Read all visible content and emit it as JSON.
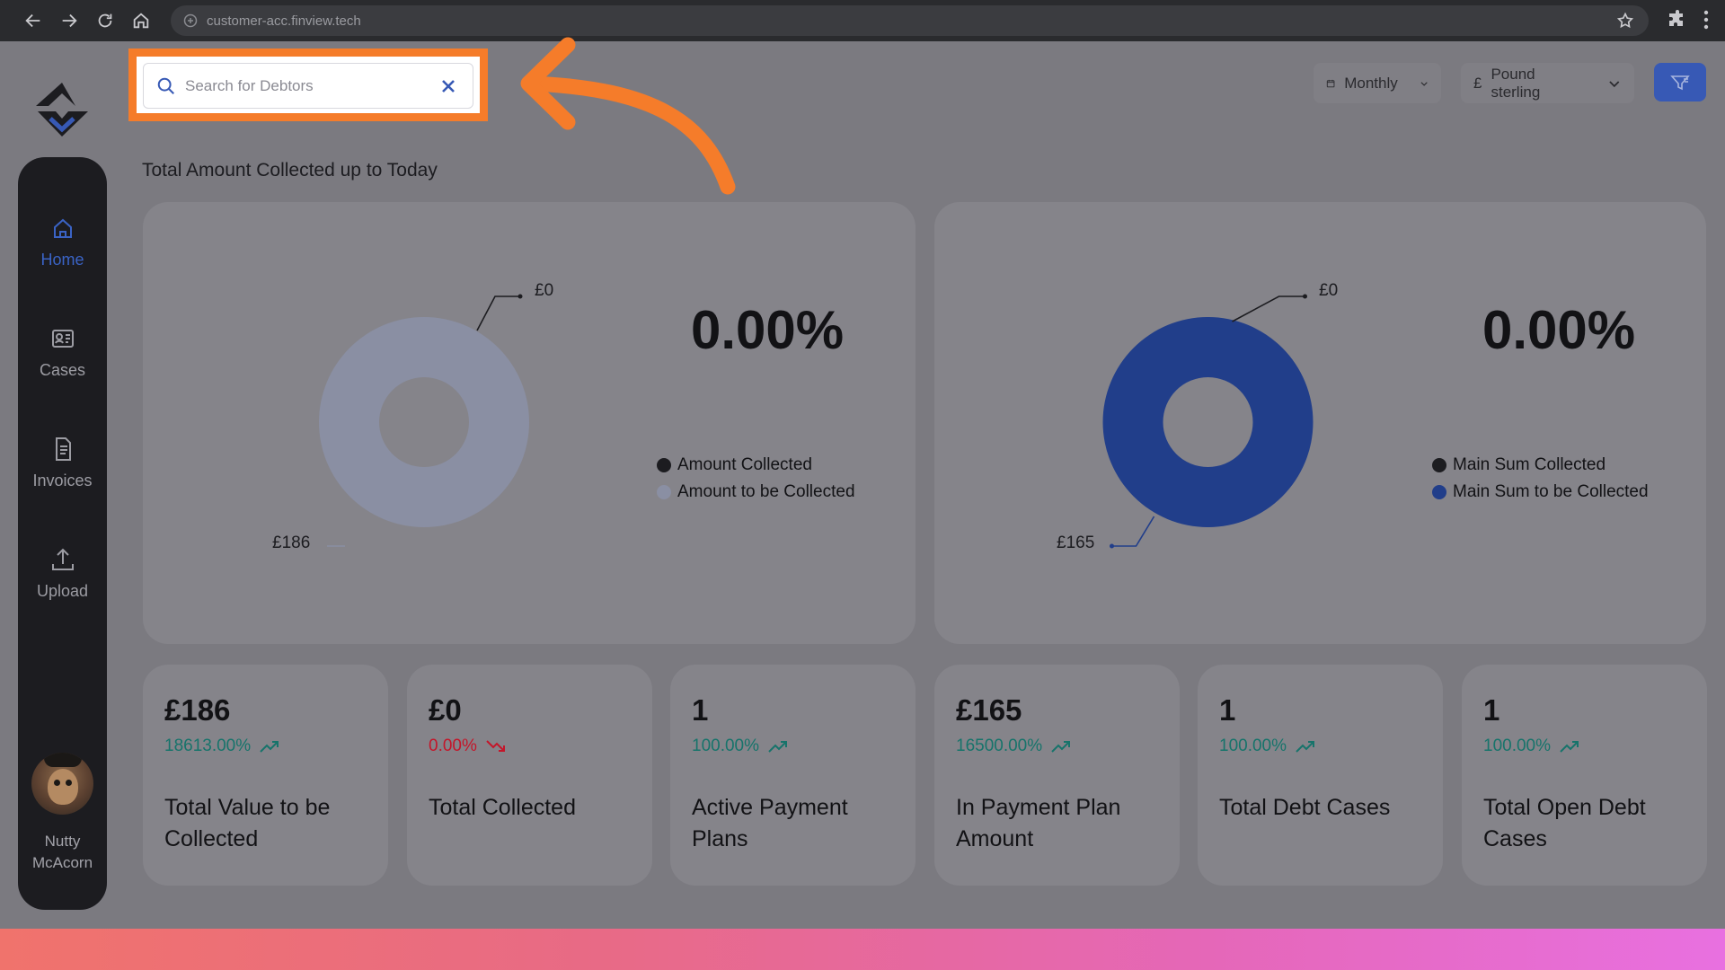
{
  "browser": {
    "url": "customer-acc.finview.tech"
  },
  "search": {
    "placeholder": "Search for Debtors"
  },
  "controls": {
    "period": "Monthly",
    "currency_symbol": "£",
    "currency": "Pound sterling"
  },
  "sidebar": {
    "items": [
      {
        "label": "Home",
        "icon": "home-icon",
        "active": true
      },
      {
        "label": "Cases",
        "icon": "id-card-icon"
      },
      {
        "label": "Invoices",
        "icon": "document-icon"
      },
      {
        "label": "Upload",
        "icon": "upload-icon"
      }
    ],
    "user_first": "Nutty",
    "user_last": "McAcorn"
  },
  "section_title": "Total Amount Collected up to Today",
  "charts": {
    "left": {
      "percent": "0.00%",
      "label_collected": "£0",
      "label_remaining": "£186",
      "legend": [
        "Amount Collected",
        "Amount to be Collected"
      ]
    },
    "right": {
      "percent": "0.00%",
      "label_collected": "£0",
      "label_remaining": "£165",
      "legend": [
        "Main Sum Collected",
        "Main Sum to be Collected"
      ]
    }
  },
  "chart_data": [
    {
      "type": "pie",
      "categories": [
        "Amount Collected",
        "Amount to be Collected"
      ],
      "values": [
        0,
        186
      ],
      "data_labels": [
        "£0",
        "£186"
      ],
      "colors": [
        "#1c1c20",
        "#8a8fa3"
      ]
    },
    {
      "type": "pie",
      "categories": [
        "Main Sum Collected",
        "Main Sum to be Collected"
      ],
      "values": [
        0,
        165
      ],
      "data_labels": [
        "£0",
        "£165"
      ],
      "colors": [
        "#1c1c20",
        "#213e8a"
      ]
    }
  ],
  "stats": [
    {
      "value": "£186",
      "change": "18613.00%",
      "trend": "up",
      "label": "Total Value to be Collected"
    },
    {
      "value": "£0",
      "change": "0.00%",
      "trend": "down",
      "label": "Total Collected"
    },
    {
      "value": "1",
      "change": "100.00%",
      "trend": "up",
      "label": "Active Payment Plans"
    },
    {
      "value": "£165",
      "change": "16500.00%",
      "trend": "up",
      "label": "In Payment Plan Amount"
    },
    {
      "value": "1",
      "change": "100.00%",
      "trend": "up",
      "label": "Total Debt Cases"
    },
    {
      "value": "1",
      "change": "100.00%",
      "trend": "up",
      "label": "Total Open Debt Cases"
    }
  ],
  "colors": {
    "accent": "#3759b5",
    "highlight": "#f57c2a",
    "positive": "#17746b",
    "negative": "#c4162a"
  }
}
